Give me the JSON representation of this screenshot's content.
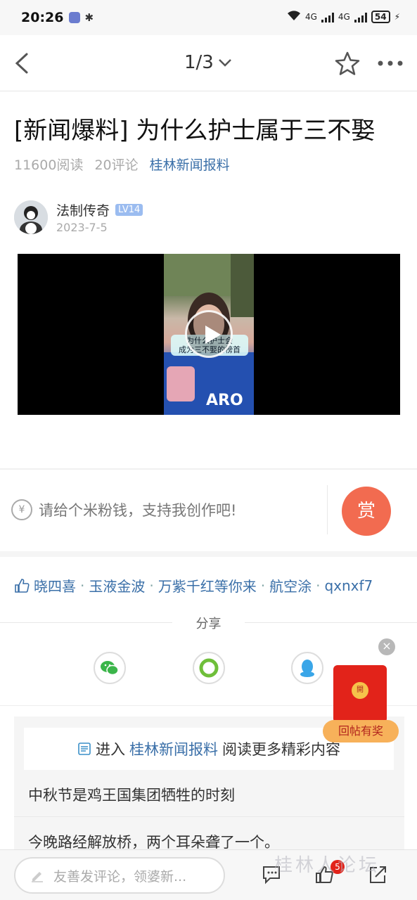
{
  "status_bar": {
    "time": "20:26",
    "battery": "54",
    "network_1": "4G",
    "network_2": "4G"
  },
  "nav": {
    "pager": "1/3"
  },
  "post": {
    "title": "[新闻爆料] 为什么护士属于三不娶",
    "reads": "11600阅读",
    "comments": "20评论",
    "forum": "桂林新闻报料",
    "author": "法制传奇",
    "level": "LV14",
    "date": "2023-7-5"
  },
  "video": {
    "caption_line1": "为什么护士会",
    "caption_line2": "成为三不娶的榜首"
  },
  "tip": {
    "prompt": "请给个米粉钱，支持我创作吧!",
    "button": "赏",
    "icon_text": "¥"
  },
  "likes": {
    "users": [
      "晓四喜",
      "玉液金波",
      "万紫千红等你来",
      "航空涂",
      "qxnxf7"
    ],
    "separator": "·"
  },
  "share": {
    "label": "分享",
    "targets": [
      "wechat-icon",
      "moments-icon",
      "qq-icon"
    ]
  },
  "redpack": {
    "coin": "開",
    "label": "回帖有奖",
    "close": "×"
  },
  "related": {
    "enter_prefix": "进入",
    "forum_link": "桂林新闻报料",
    "enter_suffix": "阅读更多精彩内容",
    "items": [
      "中秋节是鸡王国集团牺牲的时刻",
      "今晚路经解放桥，两个耳朵聋了一个。"
    ]
  },
  "bottom": {
    "comment_placeholder": "友善发评论，领婆新...",
    "badge": "5"
  },
  "watermark": "桂林人论坛",
  "colors": {
    "link": "#3a6fa8",
    "reward": "#f26b50",
    "red_packet": "#e2231a"
  }
}
